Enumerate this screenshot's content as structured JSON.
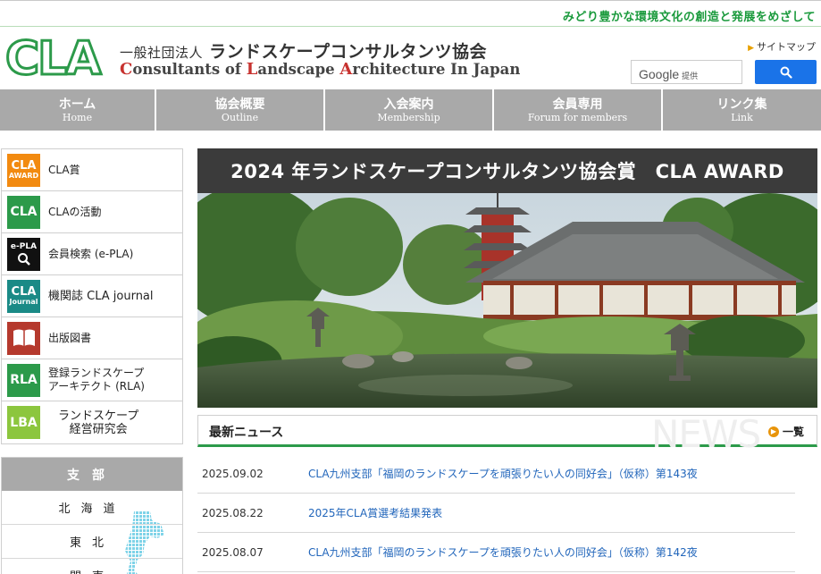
{
  "header": {
    "tagline": "みどり豊かな環境文化の創造と発展をめざして",
    "logo_text": "CLA",
    "org_prefix": "一般社団法人",
    "org_name_jp": "ランドスケープコンサルタンツ協会",
    "org_name_en": "Consultants of Landscape Architecture In Japan",
    "sitemap_label": "サイトマップ",
    "search": {
      "brand": "Google",
      "provider": "提供"
    }
  },
  "nav": {
    "items": [
      {
        "jp": "ホーム",
        "en": "Home"
      },
      {
        "jp": "協会概要",
        "en": "Outline"
      },
      {
        "jp": "入会案内",
        "en": "Membership"
      },
      {
        "jp": "会員専用",
        "en": "Forum for members"
      },
      {
        "jp": "リンク集",
        "en": "Link"
      }
    ]
  },
  "sidebar": {
    "items": [
      {
        "icon_top": "CLA",
        "icon_bottom": "AWARD",
        "label": "CLA賞",
        "color": "#f28a10"
      },
      {
        "icon_top": "CLA",
        "icon_bottom": "",
        "label": "CLAの活動",
        "color": "#2c9a4a"
      },
      {
        "icon_top": "e-PLA",
        "icon_bottom": "",
        "label": "会員検索 (e-PLA)",
        "color": "#111111"
      },
      {
        "icon_top": "CLA",
        "icon_bottom": "Journal",
        "label": "機関誌 CLA journal",
        "color": "#1a8a86"
      },
      {
        "icon_top": "",
        "icon_bottom": "",
        "label": "出版図書",
        "color": "#b5392d"
      },
      {
        "icon_top": "RLA",
        "icon_bottom": "",
        "label": "登録ランドスケープ",
        "label2": "アーキテクト (RLA)",
        "color": "#2c9a4a"
      },
      {
        "icon_top": "LBA",
        "icon_bottom": "",
        "label": "ランドスケープ",
        "label2": "経営研究会",
        "color": "#8cc63e"
      }
    ]
  },
  "branches": {
    "heading": "支部",
    "items": [
      "北海道",
      "東北",
      "関東"
    ]
  },
  "award": {
    "title": "2024 年ランドスケープコンサルタンツ協会賞　CLA AWARD"
  },
  "news": {
    "label": "最新ニュース",
    "watermark": "NEWS",
    "more_label": "一覧",
    "items": [
      {
        "date": "2025.09.02",
        "title": "CLA九州支部「福岡のランドスケープを頑張りたい人の同好会」（仮称）第143夜"
      },
      {
        "date": "2025.08.22",
        "title": "2025年CLA賞選考結果発表"
      },
      {
        "date": "2025.08.07",
        "title": "CLA九州支部「福岡のランドスケープを頑張りたい人の同好会」（仮称）第142夜"
      }
    ]
  },
  "colors": {
    "brand_green": "#2c9a4a",
    "nav_gray": "#a9a9a9",
    "link_blue": "#2266bb",
    "search_blue": "#1a73e8"
  }
}
